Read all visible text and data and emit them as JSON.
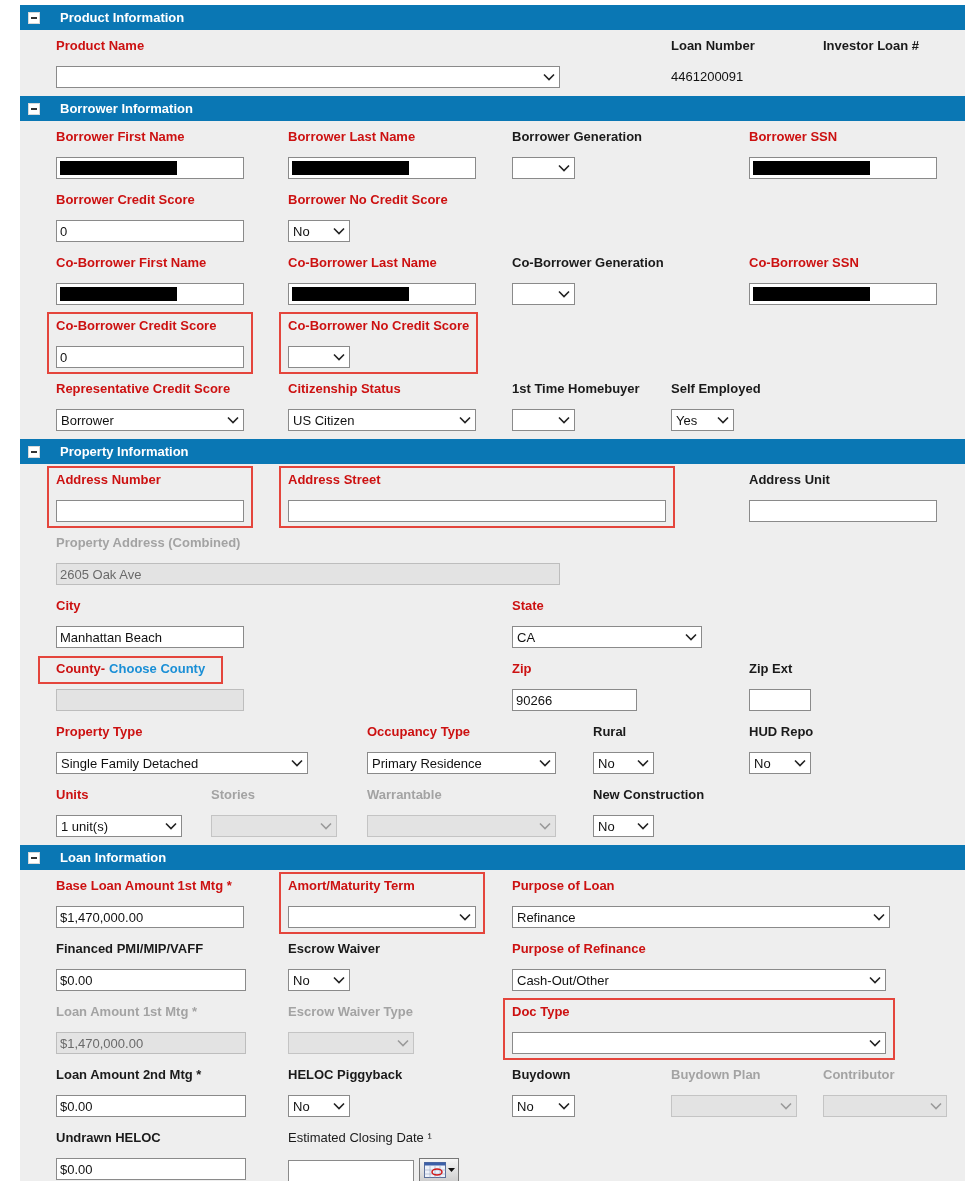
{
  "sections": [
    {
      "title": "Product Information",
      "expanded": true,
      "rows": [
        {
          "fields": [
            {
              "label": "Product Name",
              "required": true,
              "bold": true,
              "kind": "select",
              "disabled": false,
              "highlighted": false,
              "label_highlighted": false
            },
            {
              "label": "Loan Number",
              "required": false,
              "bold": true,
              "kind": "static",
              "value": "4461200091",
              "highlighted": false,
              "label_highlighted": false
            },
            {
              "label": "Investor Loan #",
              "required": false,
              "bold": true,
              "kind": "label",
              "highlighted": false,
              "label_highlighted": false
            }
          ]
        }
      ]
    },
    {
      "title": "Borrower Information",
      "expanded": true,
      "rows": [
        {
          "fields": [
            {
              "label": "Borrower First Name",
              "required": true,
              "bold": true,
              "kind": "text",
              "redacted": true,
              "disabled": false,
              "highlighted": false,
              "label_highlighted": false
            },
            {
              "label": "Borrower Last Name",
              "required": true,
              "bold": true,
              "kind": "text",
              "redacted": true,
              "disabled": false,
              "highlighted": false,
              "label_highlighted": false
            },
            {
              "label": "Borrower Generation",
              "required": false,
              "bold": true,
              "kind": "select",
              "disabled": false,
              "highlighted": false,
              "label_highlighted": false
            },
            {
              "label": "Borrower SSN",
              "required": true,
              "bold": true,
              "kind": "text",
              "redacted": true,
              "disabled": false,
              "highlighted": false,
              "label_highlighted": false
            }
          ]
        },
        {
          "fields": [
            {
              "label": "Borrower Credit Score",
              "required": true,
              "bold": true,
              "kind": "text",
              "value": "0",
              "redacted": false,
              "disabled": false,
              "highlighted": false,
              "label_highlighted": false
            },
            {
              "label": "Borrower No Credit Score",
              "required": true,
              "bold": true,
              "kind": "select",
              "value": "No",
              "disabled": false,
              "highlighted": false,
              "label_highlighted": false
            }
          ]
        },
        {
          "fields": [
            {
              "label": "Co-Borrower First Name",
              "required": true,
              "bold": true,
              "kind": "text",
              "redacted": true,
              "disabled": false,
              "highlighted": false,
              "label_highlighted": false
            },
            {
              "label": "Co-Borrower Last Name",
              "required": true,
              "bold": true,
              "kind": "text",
              "redacted": true,
              "disabled": false,
              "highlighted": false,
              "label_highlighted": false
            },
            {
              "label": "Co-Borrower Generation",
              "required": false,
              "bold": true,
              "kind": "select",
              "disabled": false,
              "highlighted": false,
              "label_highlighted": false
            },
            {
              "label": "Co-Borrower SSN",
              "required": true,
              "bold": true,
              "kind": "text",
              "redacted": true,
              "disabled": false,
              "highlighted": false,
              "label_highlighted": false
            }
          ]
        },
        {
          "fields": [
            {
              "label": "Co-Borrower Credit Score",
              "required": true,
              "bold": true,
              "kind": "text",
              "value": "0",
              "redacted": false,
              "disabled": false,
              "highlighted": true,
              "label_highlighted": false
            },
            {
              "label": "Co-Borrower No Credit Score",
              "required": true,
              "bold": true,
              "kind": "select",
              "disabled": false,
              "highlighted": true,
              "label_highlighted": false
            }
          ]
        },
        {
          "fields": [
            {
              "label": "Representative Credit Score",
              "required": true,
              "bold": true,
              "kind": "select",
              "value": "Borrower",
              "disabled": false,
              "highlighted": false,
              "label_highlighted": false
            },
            {
              "label": "Citizenship Status",
              "required": true,
              "bold": true,
              "kind": "select",
              "value": "US Citizen",
              "disabled": false,
              "highlighted": false,
              "label_highlighted": false
            },
            {
              "label": "1st Time Homebuyer",
              "required": false,
              "bold": true,
              "kind": "select",
              "disabled": false,
              "highlighted": false,
              "label_highlighted": false
            },
            {
              "label": "Self Employed",
              "required": false,
              "bold": true,
              "kind": "select",
              "value": "Yes",
              "disabled": false,
              "highlighted": false,
              "label_highlighted": false
            }
          ]
        }
      ]
    },
    {
      "title": "Property Information",
      "expanded": true,
      "rows": [
        {
          "fields": [
            {
              "label": "Address Number",
              "required": true,
              "bold": true,
              "kind": "text",
              "redacted": false,
              "disabled": false,
              "highlighted": true,
              "label_highlighted": false
            },
            {
              "label": "Address Street",
              "required": true,
              "bold": true,
              "kind": "text",
              "redacted": false,
              "disabled": false,
              "highlighted": true,
              "label_highlighted": false
            },
            {
              "label": "Address Unit",
              "required": false,
              "bold": true,
              "kind": "text",
              "redacted": false,
              "disabled": false,
              "highlighted": false,
              "label_highlighted": false
            }
          ]
        },
        {
          "fields": [
            {
              "label": "Property Address (Combined)",
              "required": false,
              "bold": true,
              "kind": "text",
              "value": "2605 Oak Ave",
              "redacted": false,
              "disabled": true,
              "highlighted": false,
              "label_highlighted": false
            }
          ]
        },
        {
          "fields": [
            {
              "label": "City",
              "required": true,
              "bold": true,
              "kind": "text",
              "value": "Manhattan Beach",
              "redacted": false,
              "disabled": false,
              "highlighted": false,
              "label_highlighted": false
            },
            {
              "label": "State",
              "required": true,
              "bold": true,
              "kind": "select",
              "value": "CA",
              "disabled": false,
              "highlighted": false,
              "label_highlighted": false
            }
          ]
        },
        {
          "fields": [
            {
              "label": "County-",
              "link": "Choose County",
              "required": true,
              "bold": true,
              "kind": "text",
              "redacted": false,
              "disabled": true,
              "highlighted": false,
              "label_highlighted": true
            },
            {
              "label": "Zip",
              "required": true,
              "bold": true,
              "kind": "text",
              "value": "90266",
              "redacted": false,
              "disabled": false,
              "highlighted": false,
              "label_highlighted": false
            },
            {
              "label": "Zip Ext",
              "required": false,
              "bold": true,
              "kind": "text",
              "redacted": false,
              "disabled": false,
              "highlighted": false,
              "label_highlighted": false
            }
          ]
        },
        {
          "fields": [
            {
              "label": "Property Type",
              "required": true,
              "bold": true,
              "kind": "select",
              "value": "Single Family Detached",
              "disabled": false,
              "highlighted": false,
              "label_highlighted": false
            },
            {
              "label": "Occupancy Type",
              "required": true,
              "bold": true,
              "kind": "select",
              "value": "Primary Residence",
              "disabled": false,
              "highlighted": false,
              "label_highlighted": false
            },
            {
              "label": "Rural",
              "required": false,
              "bold": true,
              "kind": "select",
              "value": "No",
              "disabled": false,
              "highlighted": false,
              "label_highlighted": false
            },
            {
              "label": "HUD Repo",
              "required": false,
              "bold": true,
              "kind": "select",
              "value": "No",
              "disabled": false,
              "highlighted": false,
              "label_highlighted": false
            }
          ]
        },
        {
          "fields": [
            {
              "label": "Units",
              "required": true,
              "bold": true,
              "kind": "select",
              "value": "1 unit(s)",
              "disabled": false,
              "highlighted": false,
              "label_highlighted": false
            },
            {
              "label": "Stories",
              "required": false,
              "bold": true,
              "kind": "select",
              "disabled": true,
              "highlighted": false,
              "label_highlighted": false
            },
            {
              "label": "Warrantable",
              "required": false,
              "bold": true,
              "kind": "select",
              "disabled": true,
              "highlighted": false,
              "label_highlighted": false
            },
            {
              "label": "New Construction",
              "required": false,
              "bold": true,
              "kind": "select",
              "value": "No",
              "disabled": false,
              "highlighted": false,
              "label_highlighted": false
            }
          ]
        }
      ]
    },
    {
      "title": "Loan Information",
      "expanded": true,
      "rows": [
        {
          "fields": [
            {
              "label": "Base Loan Amount 1st Mtg *",
              "required": true,
              "bold": true,
              "kind": "text",
              "value": "$1,470,000.00",
              "redacted": false,
              "disabled": false,
              "highlighted": false,
              "label_highlighted": false
            },
            {
              "label": "Amort/Maturity Term",
              "required": true,
              "bold": true,
              "kind": "select",
              "disabled": false,
              "highlighted": true,
              "label_highlighted": false
            },
            {
              "label": "Purpose of Loan",
              "required": true,
              "bold": true,
              "kind": "select",
              "value": "Refinance",
              "disabled": false,
              "highlighted": false,
              "label_highlighted": false
            }
          ]
        },
        {
          "fields": [
            {
              "label": "Financed PMI/MIP/VAFF",
              "required": false,
              "bold": true,
              "kind": "text",
              "value": "$0.00",
              "redacted": false,
              "disabled": false,
              "highlighted": false,
              "label_highlighted": false
            },
            {
              "label": "Escrow Waiver",
              "required": false,
              "bold": true,
              "kind": "select",
              "value": "No",
              "disabled": false,
              "highlighted": false,
              "label_highlighted": false
            },
            {
              "label": "Purpose of Refinance",
              "required": true,
              "bold": true,
              "kind": "select",
              "value": "Cash-Out/Other",
              "disabled": false,
              "highlighted": false,
              "label_highlighted": false
            }
          ]
        },
        {
          "fields": [
            {
              "label": "Loan Amount 1st Mtg *",
              "required": false,
              "bold": true,
              "kind": "text",
              "value": "$1,470,000.00",
              "redacted": false,
              "disabled": true,
              "highlighted": false,
              "label_highlighted": false
            },
            {
              "label": "Escrow Waiver Type",
              "required": false,
              "bold": true,
              "kind": "select",
              "disabled": true,
              "highlighted": false,
              "label_highlighted": false
            },
            {
              "label": "Doc Type",
              "required": true,
              "bold": true,
              "kind": "select",
              "disabled": false,
              "highlighted": true,
              "label_highlighted": false
            }
          ]
        },
        {
          "fields": [
            {
              "label": "Loan Amount 2nd Mtg *",
              "required": false,
              "bold": true,
              "kind": "text",
              "value": "$0.00",
              "redacted": false,
              "disabled": false,
              "highlighted": false,
              "label_highlighted": false
            },
            {
              "label": "HELOC Piggyback",
              "required": false,
              "bold": true,
              "kind": "select",
              "value": "No",
              "disabled": false,
              "highlighted": false,
              "label_highlighted": false
            },
            {
              "label": "Buydown",
              "required": false,
              "bold": true,
              "kind": "select",
              "value": "No",
              "disabled": false,
              "highlighted": false,
              "label_highlighted": false
            },
            {
              "label": "Buydown Plan",
              "required": false,
              "bold": true,
              "kind": "select",
              "disabled": true,
              "highlighted": false,
              "label_highlighted": false
            },
            {
              "label": "Contributor",
              "required": false,
              "bold": true,
              "kind": "select",
              "disabled": true,
              "highlighted": false,
              "label_highlighted": false
            }
          ]
        },
        {
          "fields": [
            {
              "label": "Undrawn HELOC",
              "required": false,
              "bold": true,
              "kind": "text",
              "value": "$0.00",
              "redacted": false,
              "disabled": false,
              "highlighted": false,
              "label_highlighted": false
            },
            {
              "label": "Estimated Closing Date ¹",
              "required": false,
              "bold": false,
              "kind": "date",
              "disabled": false,
              "highlighted": false,
              "label_highlighted": false
            }
          ]
        }
      ]
    }
  ]
}
